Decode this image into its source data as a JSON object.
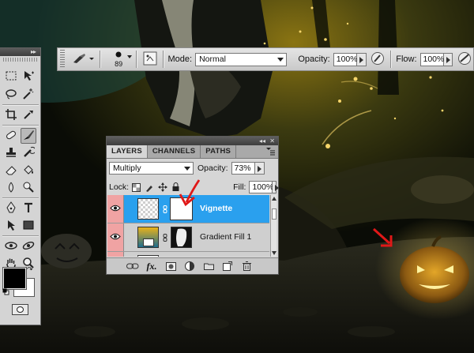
{
  "options_bar": {
    "brush_size": "89",
    "mode_label": "Mode:",
    "mode_value": "Normal",
    "opacity_label": "Opacity:",
    "opacity_value": "100%",
    "flow_label": "Flow:",
    "flow_value": "100%",
    "icons": [
      "brush-preset-icon",
      "brush-picker-icon",
      "toggle-brush-panel-icon",
      "pressure-opacity-icon",
      "airbrush-icon"
    ]
  },
  "tools_panel": {
    "collapse_glyph": "▸▸",
    "tools": [
      "marquee",
      "move",
      "lasso",
      "magic-wand",
      "crop",
      "eyedropper",
      "healing-brush",
      "brush",
      "clone-stamp",
      "history-brush",
      "eraser",
      "paint-bucket",
      "blur",
      "dodge",
      "pen",
      "type",
      "path-selection",
      "shape",
      "3d-rotate",
      "3d-orbit",
      "hand",
      "zoom"
    ],
    "active_tool": "brush",
    "foreground_color": "#000000",
    "background_color": "#ffffff"
  },
  "layers_panel": {
    "tabs": [
      "LAYERS",
      "CHANNELS",
      "PATHS"
    ],
    "active_tab": "LAYERS",
    "blend_mode": "Multiply",
    "opacity_label": "Opacity:",
    "opacity_value": "73%",
    "lock_label": "Lock:",
    "fill_label": "Fill:",
    "fill_value": "100%",
    "layers": [
      {
        "name": "Vignette",
        "selected": true,
        "visible": true
      },
      {
        "name": "Gradient Fill 1",
        "selected": false,
        "visible": true
      }
    ],
    "footer_icons": [
      "link-layers-icon",
      "fx-icon",
      "add-mask-icon",
      "adjustment-layer-icon",
      "new-group-icon",
      "new-layer-icon",
      "delete-layer-icon"
    ],
    "fx_label": "fx."
  },
  "colors": {
    "selection": "#2aa0ee",
    "eye_cell": "#f0a3a3",
    "annotation_arrow": "#e01818",
    "glow": "#f5c040"
  }
}
